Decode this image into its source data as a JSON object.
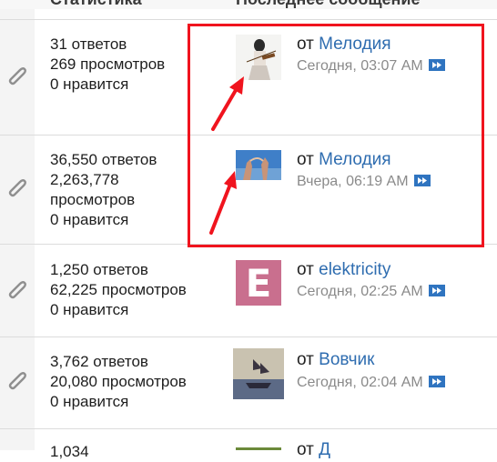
{
  "header": {
    "stats_col": "Статистика",
    "last_col": "Последнее сообщение"
  },
  "colors": {
    "link": "#2f6db0",
    "highlight": "#f0141e",
    "goto_button": "#2f74c0"
  },
  "threads": [
    {
      "replies": "31 ответов",
      "views": "269 просмотров",
      "views_label": "",
      "likes": "0 нравится",
      "from": "от",
      "author": "Мелодия",
      "time": "Сегодня, 03:07 AM",
      "avatar": "violinist-avatar"
    },
    {
      "replies": "36,550 ответов",
      "views": "2,263,778",
      "views_label": "просмотров",
      "likes": "0 нравится",
      "from": "от",
      "author": "Мелодия",
      "time": "Вчера, 06:19 AM",
      "avatar": "hands-sky-avatar"
    },
    {
      "replies": "1,250 ответов",
      "views": "62,225 просмотров",
      "views_label": "",
      "likes": "0 нравится",
      "from": "от",
      "author": "elektricity",
      "time": "Сегодня, 02:25 AM",
      "avatar": "letter-e-avatar",
      "avatar_letter": "E"
    },
    {
      "replies": "3,762 ответов",
      "views": "20,080 просмотров",
      "views_label": "",
      "likes": "0 нравится",
      "from": "от",
      "author": "Вовчик",
      "time": "Сегодня, 02:04 AM",
      "avatar": "ship-avatar"
    },
    {
      "replies": "1,034",
      "views": "",
      "views_label": "",
      "likes": "",
      "from": "от",
      "author": "Д",
      "time": "",
      "avatar": "nature-avatar"
    }
  ]
}
